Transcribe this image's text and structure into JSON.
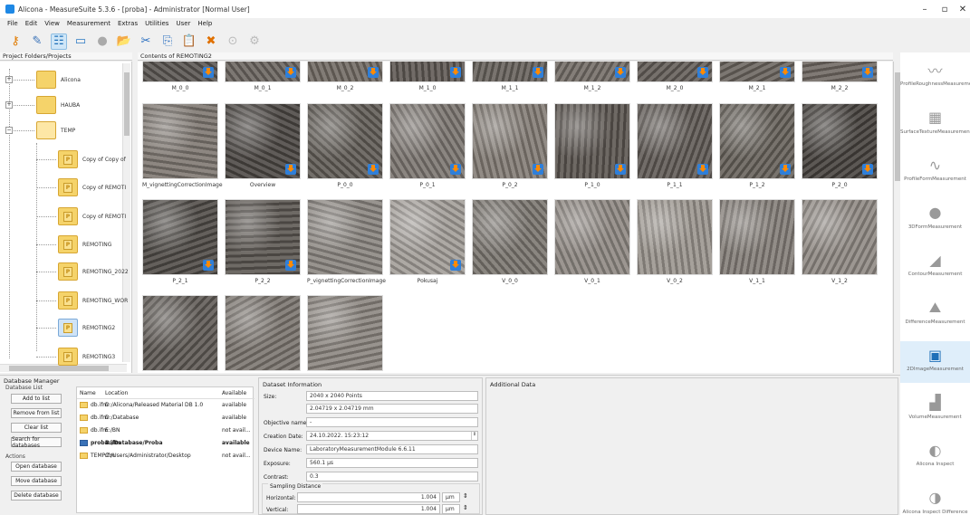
{
  "window": {
    "title": "Alicona - MeasureSuite 5.3.6 - [proba] - Administrator [Normal User]"
  },
  "menu": [
    "File",
    "Edit",
    "View",
    "Measurement",
    "Extras",
    "Utilities",
    "User",
    "Help"
  ],
  "toolbar_icons": [
    "key-icon",
    "tools-icon",
    "tree-view-icon",
    "monitor-icon",
    "sphere-icon",
    "open-folder-icon",
    "scissors-icon",
    "copy-icon",
    "paste-icon",
    "delete-icon",
    "disabled-tool-icon",
    "disabled-tool2-icon"
  ],
  "left_panel": {
    "header": "Project Folders/Projects",
    "items": [
      {
        "label": "Alicona",
        "type": "folder"
      },
      {
        "label": "HAUBA",
        "type": "folder"
      },
      {
        "label": "TEMP",
        "type": "open-folder"
      },
      {
        "label": "Copy of Copy of",
        "type": "project"
      },
      {
        "label": "Copy of REMOTI",
        "type": "project"
      },
      {
        "label": "Copy of REMOTI",
        "type": "project"
      },
      {
        "label": "REMOTING",
        "type": "project"
      },
      {
        "label": "REMOTING_2022",
        "type": "project"
      },
      {
        "label": "REMOTING_WOR",
        "type": "project"
      },
      {
        "label": "REMOTING2",
        "type": "project-selected"
      },
      {
        "label": "REMOTING3",
        "type": "project"
      }
    ]
  },
  "content": {
    "header": "Contents of REMOTING2",
    "thumbnails": [
      {
        "label": "M_0_0",
        "tone": "#5a5652",
        "dl": true
      },
      {
        "label": "M_0_1",
        "tone": "#6b6560",
        "dl": true
      },
      {
        "label": "M_0_2",
        "tone": "#716a63",
        "dl": true
      },
      {
        "label": "M_1_0",
        "tone": "#5e5853",
        "dl": true
      },
      {
        "label": "M_1_1",
        "tone": "#67615b",
        "dl": true
      },
      {
        "label": "M_1_2",
        "tone": "#736c66",
        "dl": true
      },
      {
        "label": "M_2_0",
        "tone": "#635d58",
        "dl": true
      },
      {
        "label": "M_2_1",
        "tone": "#6a645e",
        "dl": true
      },
      {
        "label": "M_2_2",
        "tone": "#6f6862",
        "dl": true
      },
      {
        "label": "M_vignettingCorrectionImage",
        "tone": "#7d7670",
        "dl": false
      },
      {
        "label": "Overview",
        "tone": "#4a4642",
        "dl": true
      },
      {
        "label": "P_0_0",
        "tone": "#605b55",
        "dl": true
      },
      {
        "label": "P_0_1",
        "tone": "#7b7570",
        "dl": true
      },
      {
        "label": "P_0_2",
        "tone": "#827b74",
        "dl": true
      },
      {
        "label": "P_1_0",
        "tone": "#5a544f",
        "dl": true
      },
      {
        "label": "P_1_1",
        "tone": "#5f5954",
        "dl": true
      },
      {
        "label": "P_1_2",
        "tone": "#656059",
        "dl": true
      },
      {
        "label": "P_2_0",
        "tone": "#45413d",
        "dl": true
      },
      {
        "label": "P_2_1",
        "tone": "#4e4a46",
        "dl": true
      },
      {
        "label": "P_2_2",
        "tone": "#5a5550",
        "dl": true
      },
      {
        "label": "P_vignettingCorrectionImage",
        "tone": "#8a8580",
        "dl": false
      },
      {
        "label": "Pokusaj",
        "tone": "#a29d98",
        "dl": true
      },
      {
        "label": "V_0_0",
        "tone": "#7a756f",
        "dl": false
      },
      {
        "label": "V_0_1",
        "tone": "#8e8882",
        "dl": false
      },
      {
        "label": "V_0_2",
        "tone": "#9a948d",
        "dl": false
      },
      {
        "label": "V_1_1",
        "tone": "#837d77",
        "dl": false
      },
      {
        "label": "V_1_2",
        "tone": "#8f8983",
        "dl": false
      },
      {
        "label": "",
        "tone": "#5e5954",
        "dl": false
      },
      {
        "label": "",
        "tone": "#7a746e",
        "dl": false
      },
      {
        "label": "",
        "tone": "#8a847e",
        "dl": false
      }
    ]
  },
  "right_sidebar": [
    {
      "label": "ProfileRoughnessMeasurement",
      "icon": "profile-roughness-icon",
      "glyph": "〰"
    },
    {
      "label": "SurfaceTextureMeasurement",
      "icon": "surface-texture-icon",
      "glyph": "▦"
    },
    {
      "label": "ProfileFormMeasurement",
      "icon": "profile-form-icon",
      "glyph": "∿"
    },
    {
      "label": "3DFormMeasurement",
      "icon": "3d-form-icon",
      "glyph": "●"
    },
    {
      "label": "ContourMeasurement",
      "icon": "contour-icon",
      "glyph": "◢"
    },
    {
      "label": "DifferenceMeasurement",
      "icon": "difference-icon",
      "glyph": "⛰"
    },
    {
      "label": "2DImageMeasurement",
      "icon": "2d-image-icon",
      "glyph": "▣"
    },
    {
      "label": "VolumeMeasurement",
      "icon": "volume-icon",
      "glyph": "▟"
    },
    {
      "label": "Alicona Inspect",
      "icon": "alicona-inspect-icon",
      "glyph": "◐"
    },
    {
      "label": "Alicona Inspect Difference",
      "icon": "inspect-difference-icon",
      "glyph": "◑"
    }
  ],
  "db_manager": {
    "title": "Database Manager",
    "list_group": "Database List",
    "buttons_list": [
      "Add to list",
      "Remove from list",
      "Clear list",
      "Search for databases"
    ],
    "actions_group": "Actions",
    "buttons_actions": [
      "Open database",
      "Move database",
      "Delete database"
    ],
    "columns": [
      "Name",
      "Location",
      "Available"
    ],
    "rows": [
      {
        "name": "db.ifm",
        "location": "D:/Alicona/Released Material DB 1.0",
        "available": "available",
        "bold": false
      },
      {
        "name": "db.ifm",
        "location": "D:/Database",
        "available": "available",
        "bold": false
      },
      {
        "name": "db.ifm",
        "location": "E:/BN",
        "available": "not avail...",
        "bold": false
      },
      {
        "name": "proba.ifm",
        "location": "D:/Database/Proba",
        "available": "available",
        "bold": true
      },
      {
        "name": "TEMP.ifm",
        "location": "C:/Users/Administrator/Desktop",
        "available": "not avail...",
        "bold": false
      }
    ]
  },
  "dataset": {
    "title": "Dataset Information",
    "size_label": "Size:",
    "size_points": "2040 x 2040 Points",
    "size_mm": "2.04719 x 2.04719 mm",
    "objective_label": "Objective name:",
    "objective_value": "-",
    "creation_label": "Creation Date:",
    "creation_value": "24.10.2022. 15:23:12",
    "device_label": "Device Name:",
    "device_value": "LaboratoryMeasurementModule 6.6.11",
    "exposure_label": "Exposure:",
    "exposure_value": "560.1 µs",
    "contrast_label": "Contrast:",
    "contrast_value": "0.3",
    "sampling_title": "Sampling Distance",
    "horizontal_label": "Horizontal:",
    "horizontal_value": "1.004",
    "vertical_label": "Vertical:",
    "vertical_value": "1.004",
    "unit": "µm"
  },
  "additional": {
    "title": "Additional Data"
  }
}
